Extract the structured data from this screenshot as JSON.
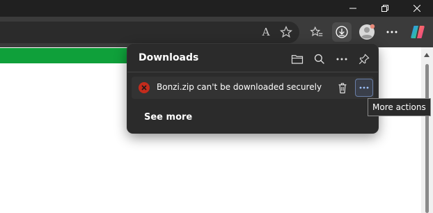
{
  "panel": {
    "title": "Downloads",
    "item": {
      "filename": "Bonzi.zip",
      "status_suffix": "can't be downloaded securely",
      "full_text": "Bonzi.zip can't be downloaded securely"
    },
    "see_more": "See more"
  },
  "tooltip": {
    "text": "More actions"
  },
  "toolbar": {
    "read_aloud_glyph": "A"
  },
  "colors": {
    "error": "#c42b1c",
    "page_green": "#0fa03a",
    "panel_bg": "#2b2b2b"
  },
  "icons": [
    "minimize-icon",
    "maximize-icon",
    "close-icon",
    "read-aloud-icon",
    "favorite-star-icon",
    "favorites-icon",
    "download-icon",
    "profile-avatar",
    "more-icon",
    "copilot-icon",
    "folder-icon",
    "search-icon",
    "pin-icon",
    "error-icon",
    "trash-icon"
  ]
}
